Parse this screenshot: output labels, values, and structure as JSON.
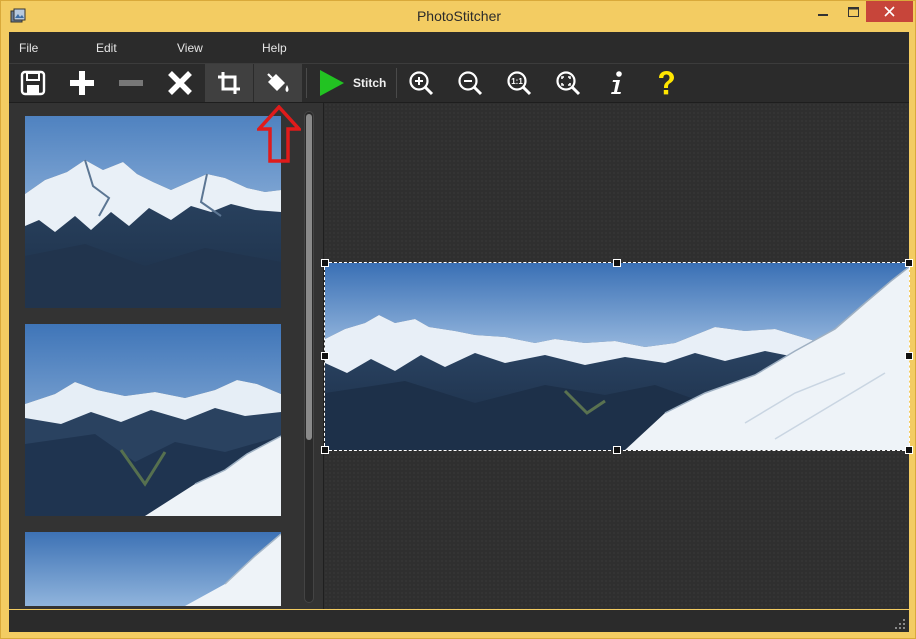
{
  "window": {
    "title": "PhotoStitcher"
  },
  "menu": {
    "items": [
      "File",
      "Edit",
      "View",
      "Help"
    ]
  },
  "toolbar": {
    "buttons": [
      {
        "icon": "save-icon"
      },
      {
        "icon": "add-icon"
      },
      {
        "icon": "remove-icon"
      },
      {
        "icon": "delete-icon"
      },
      {
        "icon": "crop-icon"
      },
      {
        "icon": "fill-bucket-icon"
      },
      {
        "icon": "zoom-in-icon"
      },
      {
        "icon": "zoom-out-icon"
      },
      {
        "icon": "zoom-actual-icon",
        "label": "1:1"
      },
      {
        "icon": "zoom-fit-icon"
      },
      {
        "icon": "info-icon"
      },
      {
        "icon": "help-icon"
      }
    ],
    "stitch_label": "Stitch"
  },
  "colors": {
    "window_frame": "#f3cc62",
    "dark_bg": "#2b2b2b",
    "stitch_green": "#22c322",
    "help_yellow": "#ffe600",
    "close_red": "#c7453a",
    "annotation_arrow": "#e01b1b"
  },
  "images": {
    "thumbnail_count": 3
  }
}
